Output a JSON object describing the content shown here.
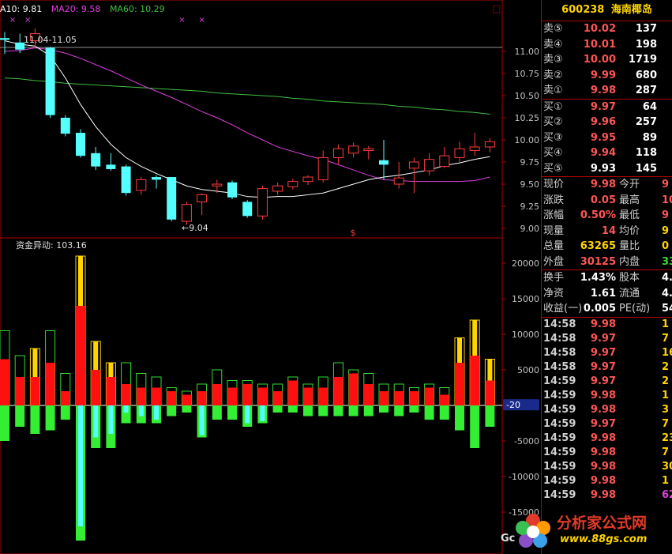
{
  "ma_legend": {
    "ma10": "A10: 9.81",
    "ma20": "MA20: 9.58",
    "ma60": "MA60: 10.29",
    "ma10_color": "#ffffff",
    "ma20_color": "#e040e0",
    "ma60_color": "#40c040"
  },
  "price_annotations": {
    "range_label": "11.04-11.05",
    "low_label": "←9.04",
    "marker": "$"
  },
  "indicator_legend": "资金异动: 103.16",
  "current_value_tag": "-20",
  "window_button": "□",
  "chart_data": [
    {
      "type": "candlestick",
      "y_ticks": [
        11.0,
        10.75,
        10.5,
        10.25,
        10.0,
        9.75,
        9.5,
        9.25,
        9.0
      ],
      "ylim": [
        8.95,
        11.3
      ],
      "candles": [
        {
          "o": 11.15,
          "h": 11.22,
          "l": 10.97,
          "c": 11.13
        },
        {
          "o": 11.1,
          "h": 11.2,
          "l": 10.98,
          "c": 11.02
        },
        {
          "o": 11.12,
          "h": 11.26,
          "l": 11.03,
          "c": 11.2
        },
        {
          "o": 11.04,
          "h": 11.05,
          "l": 10.25,
          "c": 10.28
        },
        {
          "o": 10.25,
          "h": 10.28,
          "l": 10.04,
          "c": 10.07
        },
        {
          "o": 10.08,
          "h": 10.12,
          "l": 9.8,
          "c": 9.82
        },
        {
          "o": 9.85,
          "h": 9.92,
          "l": 9.66,
          "c": 9.7
        },
        {
          "o": 9.72,
          "h": 9.85,
          "l": 9.65,
          "c": 9.67
        },
        {
          "o": 9.7,
          "h": 9.72,
          "l": 9.37,
          "c": 9.4
        },
        {
          "o": 9.43,
          "h": 9.58,
          "l": 9.38,
          "c": 9.55
        },
        {
          "o": 9.58,
          "h": 9.6,
          "l": 9.45,
          "c": 9.55
        },
        {
          "o": 9.58,
          "h": 9.58,
          "l": 9.08,
          "c": 9.1
        },
        {
          "o": 9.08,
          "h": 9.3,
          "l": 9.04,
          "c": 9.27
        },
        {
          "o": 9.3,
          "h": 9.4,
          "l": 9.15,
          "c": 9.38
        },
        {
          "o": 9.48,
          "h": 9.55,
          "l": 9.4,
          "c": 9.5
        },
        {
          "o": 9.52,
          "h": 9.54,
          "l": 9.33,
          "c": 9.35
        },
        {
          "o": 9.3,
          "h": 9.32,
          "l": 9.12,
          "c": 9.14
        },
        {
          "o": 9.14,
          "h": 9.48,
          "l": 9.1,
          "c": 9.45
        },
        {
          "o": 9.42,
          "h": 9.52,
          "l": 9.38,
          "c": 9.48
        },
        {
          "o": 9.47,
          "h": 9.56,
          "l": 9.44,
          "c": 9.53
        },
        {
          "o": 9.53,
          "h": 9.6,
          "l": 9.49,
          "c": 9.58
        },
        {
          "o": 9.55,
          "h": 9.88,
          "l": 9.52,
          "c": 9.8
        },
        {
          "o": 9.8,
          "h": 9.95,
          "l": 9.72,
          "c": 9.9
        },
        {
          "o": 9.85,
          "h": 9.97,
          "l": 9.8,
          "c": 9.93
        },
        {
          "o": 9.88,
          "h": 9.93,
          "l": 9.78,
          "c": 9.9
        },
        {
          "o": 9.77,
          "h": 10.0,
          "l": 9.55,
          "c": 9.72
        },
        {
          "o": 9.5,
          "h": 9.75,
          "l": 9.45,
          "c": 9.57
        },
        {
          "o": 9.68,
          "h": 9.8,
          "l": 9.4,
          "c": 9.75
        },
        {
          "o": 9.65,
          "h": 9.85,
          "l": 9.6,
          "c": 9.78
        },
        {
          "o": 9.7,
          "h": 9.92,
          "l": 9.68,
          "c": 9.82
        },
        {
          "o": 9.8,
          "h": 9.98,
          "l": 9.75,
          "c": 9.9
        },
        {
          "o": 9.88,
          "h": 10.08,
          "l": 9.82,
          "c": 9.92
        },
        {
          "o": 9.92,
          "h": 10.02,
          "l": 9.86,
          "c": 9.98
        }
      ],
      "ma10": [
        11.12,
        11.08,
        11.06,
        10.95,
        10.7,
        10.4,
        10.15,
        9.95,
        9.8,
        9.7,
        9.62,
        9.55,
        9.48,
        9.44,
        9.42,
        9.4,
        9.36,
        9.35,
        9.36,
        9.36,
        9.38,
        9.4,
        9.45,
        9.5,
        9.55,
        9.58,
        9.6,
        9.63,
        9.66,
        9.71,
        9.74,
        9.78,
        9.81
      ],
      "ma20": [
        11.0,
        11.01,
        11.04,
        11.02,
        10.98,
        10.92,
        10.85,
        10.78,
        10.7,
        10.62,
        10.55,
        10.48,
        10.4,
        10.32,
        10.25,
        10.17,
        10.08,
        10.0,
        9.92,
        9.87,
        9.82,
        9.78,
        9.72,
        9.66,
        9.6,
        9.55,
        9.54,
        9.53,
        9.53,
        9.53,
        9.53,
        9.54,
        9.58
      ],
      "ma60": [
        10.7,
        10.69,
        10.67,
        10.66,
        10.64,
        10.63,
        10.62,
        10.61,
        10.6,
        10.59,
        10.58,
        10.57,
        10.56,
        10.55,
        10.53,
        10.52,
        10.51,
        10.5,
        10.49,
        10.47,
        10.46,
        10.44,
        10.43,
        10.42,
        10.41,
        10.4,
        10.38,
        10.37,
        10.35,
        10.34,
        10.32,
        10.31,
        10.29
      ]
    },
    {
      "type": "bar",
      "name": "资金异动",
      "y_ticks": [
        20000,
        15000,
        10000,
        5000,
        0,
        -5000,
        -10000,
        -15000
      ],
      "ylim": [
        -19500,
        22000
      ],
      "pos_outer": [
        10500,
        7000,
        8000,
        10500,
        4500,
        21000,
        9000,
        6000,
        6000,
        4500,
        4000,
        2500,
        2000,
        3000,
        5000,
        3500,
        3500,
        3000,
        3000,
        4000,
        3000,
        4000,
        6000,
        5000,
        4500,
        3000,
        3000,
        2500,
        3000,
        2500,
        9500,
        12000,
        6500
      ],
      "pos_red": [
        6500,
        4000,
        4000,
        6000,
        2000,
        14000,
        5000,
        4000,
        3000,
        2500,
        2500,
        2000,
        1500,
        2000,
        3000,
        2500,
        3000,
        2500,
        2000,
        3500,
        2500,
        2500,
        4000,
        4500,
        3000,
        2000,
        2000,
        2000,
        2500,
        1500,
        6000,
        7000,
        3500
      ],
      "neg_outer": [
        -5000,
        -3000,
        -4000,
        -3500,
        -2000,
        -19000,
        -6000,
        -6000,
        -2500,
        -2500,
        -2500,
        -1500,
        -1000,
        -4500,
        -2000,
        -2000,
        -3000,
        -2500,
        -1000,
        -1000,
        -1500,
        -1500,
        -1500,
        -1500,
        -1500,
        -1000,
        -1500,
        -1000,
        -2000,
        -2000,
        -3500,
        -6000,
        -3000
      ],
      "neg_cyan": [
        0,
        0,
        0,
        0,
        0,
        -17000,
        -4500,
        -4000,
        -1000,
        -1500,
        -2000,
        0,
        0,
        -4200,
        0,
        0,
        -2500,
        -2200,
        0,
        0,
        0,
        0,
        0,
        0,
        0,
        0,
        0,
        0,
        0,
        0,
        0,
        0,
        0
      ],
      "highlight": [
        2,
        5,
        6,
        7,
        30,
        31,
        32
      ]
    }
  ],
  "panel": {
    "code": "600238",
    "name": "海南椰岛",
    "asks": [
      {
        "label": "卖⑤",
        "price": "10.02",
        "vol": "137"
      },
      {
        "label": "卖④",
        "price": "10.01",
        "vol": "198"
      },
      {
        "label": "卖③",
        "price": "10.00",
        "vol": "1719"
      },
      {
        "label": "卖②",
        "price": "9.99",
        "vol": "680"
      },
      {
        "label": "卖①",
        "price": "9.98",
        "vol": "287"
      }
    ],
    "bids": [
      {
        "label": "买①",
        "price": "9.97",
        "vol": "64"
      },
      {
        "label": "买②",
        "price": "9.96",
        "vol": "257"
      },
      {
        "label": "买③",
        "price": "9.95",
        "vol": "89"
      },
      {
        "label": "买④",
        "price": "9.94",
        "vol": "118"
      },
      {
        "label": "买⑤",
        "price": "9.93",
        "vol": "145"
      }
    ],
    "quote": [
      {
        "l1": "现价",
        "v1": "9.98",
        "c1": "#ff5555",
        "l2": "今开",
        "v2": "9",
        "c2": "#ff5555"
      },
      {
        "l1": "涨跌",
        "v1": "0.05",
        "c1": "#ff5555",
        "l2": "最高",
        "v2": "10",
        "c2": "#ff5555"
      },
      {
        "l1": "涨幅",
        "v1": "0.50%",
        "c1": "#ff5555",
        "l2": "最低",
        "v2": "9",
        "c2": "#ff5555"
      },
      {
        "l1": "现量",
        "v1": "14",
        "c1": "#ff5555",
        "l2": "均价",
        "v2": "9",
        "c2": "#ffd400"
      },
      {
        "l1": "总量",
        "v1": "63265",
        "c1": "#ffd400",
        "l2": "量比",
        "v2": "0",
        "c2": "#ffd400"
      },
      {
        "l1": "外盘",
        "v1": "30125",
        "c1": "#ff5555",
        "l2": "内盘",
        "v2": "33",
        "c2": "#33dd33"
      }
    ],
    "stats": [
      {
        "l1": "换手",
        "v1": "1.43%",
        "c1": "#ffffff",
        "l2": "股本",
        "v2": "4.4",
        "c2": "#ffffff"
      },
      {
        "l1": "净资",
        "v1": "1.61",
        "c1": "#ffffff",
        "l2": "流通",
        "v2": "4.4",
        "c2": "#ffffff"
      },
      {
        "l1": "收益(一)",
        "v1": "0.005",
        "c1": "#ffffff",
        "l2": "PE(动)",
        "v2": "54",
        "c2": "#ffffff"
      }
    ],
    "ticks": [
      {
        "time": "14:58",
        "price": "9.98",
        "pc": "#ff5555",
        "vol": "1"
      },
      {
        "time": "14:58",
        "price": "9.97",
        "pc": "#ff5555",
        "vol": "7"
      },
      {
        "time": "14:58",
        "price": "9.97",
        "pc": "#ff5555",
        "vol": "16"
      },
      {
        "time": "14:58",
        "price": "9.97",
        "pc": "#ff5555",
        "vol": "2"
      },
      {
        "time": "14:59",
        "price": "9.97",
        "pc": "#ff5555",
        "vol": "2"
      },
      {
        "time": "14:59",
        "price": "9.98",
        "pc": "#ff5555",
        "vol": "1"
      },
      {
        "time": "14:59",
        "price": "9.98",
        "pc": "#ff5555",
        "vol": "3"
      },
      {
        "time": "14:59",
        "price": "9.97",
        "pc": "#ff5555",
        "vol": "7"
      },
      {
        "time": "14:59",
        "price": "9.98",
        "pc": "#ff5555",
        "vol": "23"
      },
      {
        "time": "14:59",
        "price": "9.98",
        "pc": "#ff5555",
        "vol": "7"
      },
      {
        "time": "14:59",
        "price": "9.98",
        "pc": "#ff5555",
        "vol": "30"
      },
      {
        "time": "14:59",
        "price": "9.98",
        "pc": "#ff5555",
        "vol": "1"
      },
      {
        "time": "14:59",
        "price": "9.98",
        "pc": "#ff5555",
        "vol": "62"
      }
    ]
  },
  "watermark": {
    "title": "分析家公式网",
    "url": "www.88gs.com",
    "left_text": "Gc"
  }
}
